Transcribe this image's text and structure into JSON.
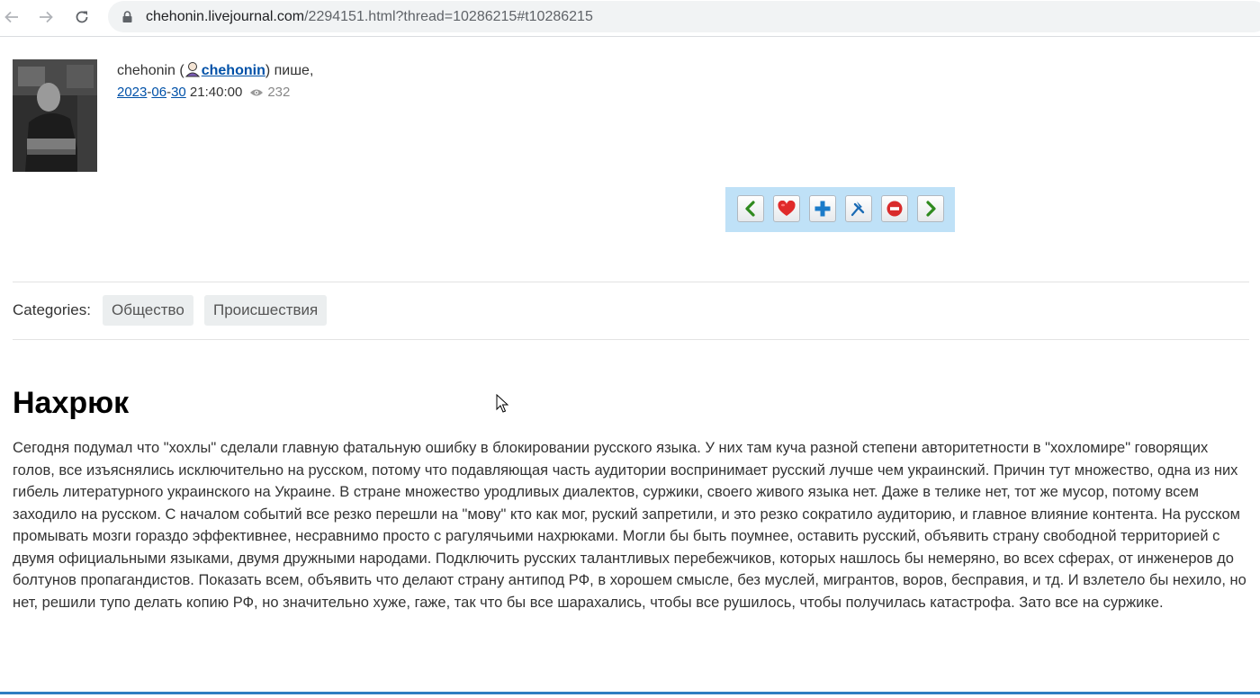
{
  "browser": {
    "url_host": "chehonin.livejournal.com",
    "url_path": "/2294151.html?thread=10286215#t10286215"
  },
  "post": {
    "poster_name": "chehonin",
    "paren_open": " (",
    "user_link": "chehonin",
    "verb": ") пише,",
    "date_year": "2023",
    "date_month": "06",
    "date_day": "30",
    "date_sep": "-",
    "time": "21:40:00",
    "views": "232"
  },
  "actions": [
    {
      "icon": "arrow-left-icon"
    },
    {
      "icon": "heart-icon"
    },
    {
      "icon": "plus-icon"
    },
    {
      "icon": "pin-icon"
    },
    {
      "icon": "minus-icon"
    },
    {
      "icon": "arrow-right-icon"
    }
  ],
  "categories": {
    "label": "Categories:",
    "tags": [
      "Общество",
      "Происшествия"
    ]
  },
  "article": {
    "title": "Нахрюк",
    "body": "Сегодня подумал что \"хохлы\" сделали главную фатальную ошибку в блокировании русского языка. У них там куча разной степени авторитетности в \"хохломире\" говорящих голов, все изъяснялись исключительно на русском, потому что подавляющая часть аудитории воспринимает русский лучше чем украинский. Причин тут множество, одна из них гибель литературного украинского на Украине. В стране множество уродливых диалектов, суржики, своего живого языка нет. Даже в телике нет, тот же мусор, потому всем заходило на русском. С началом событий все резко перешли на \"мову\" кто как мог, руский запретили, и это резко сократило аудиторию, и главное влияние контента. На русском промывать мозги гораздо эффективнее, несравнимо просто с рагулячьими нахрюками. Могли бы быть поумнее, оставить русский, объявить страну свободной территорией с двумя официальными языками, двумя дружными народами. Подключить русских талантливых перебежчиков, которых нашлось бы немеряно, во всех сферах, от инженеров до болтунов пропагандистов. Показать всем, объявить что делают страну антипод РФ, в хорошем смысле, без муслей, мигрантов, воров, бесправия, и тд. И взлетело бы нехило, но нет, решили тупо делать копию РФ, но значительно хуже, гаже, так что бы все шарахались, чтобы все рушилось, чтобы получилась катастрофа. Зато все на суржике."
  },
  "colors": {
    "link": "#0051a8",
    "actions_bg": "#bfe1f7",
    "tag_bg": "#ebeeef",
    "bottom_bar": "#2f7dc0"
  }
}
